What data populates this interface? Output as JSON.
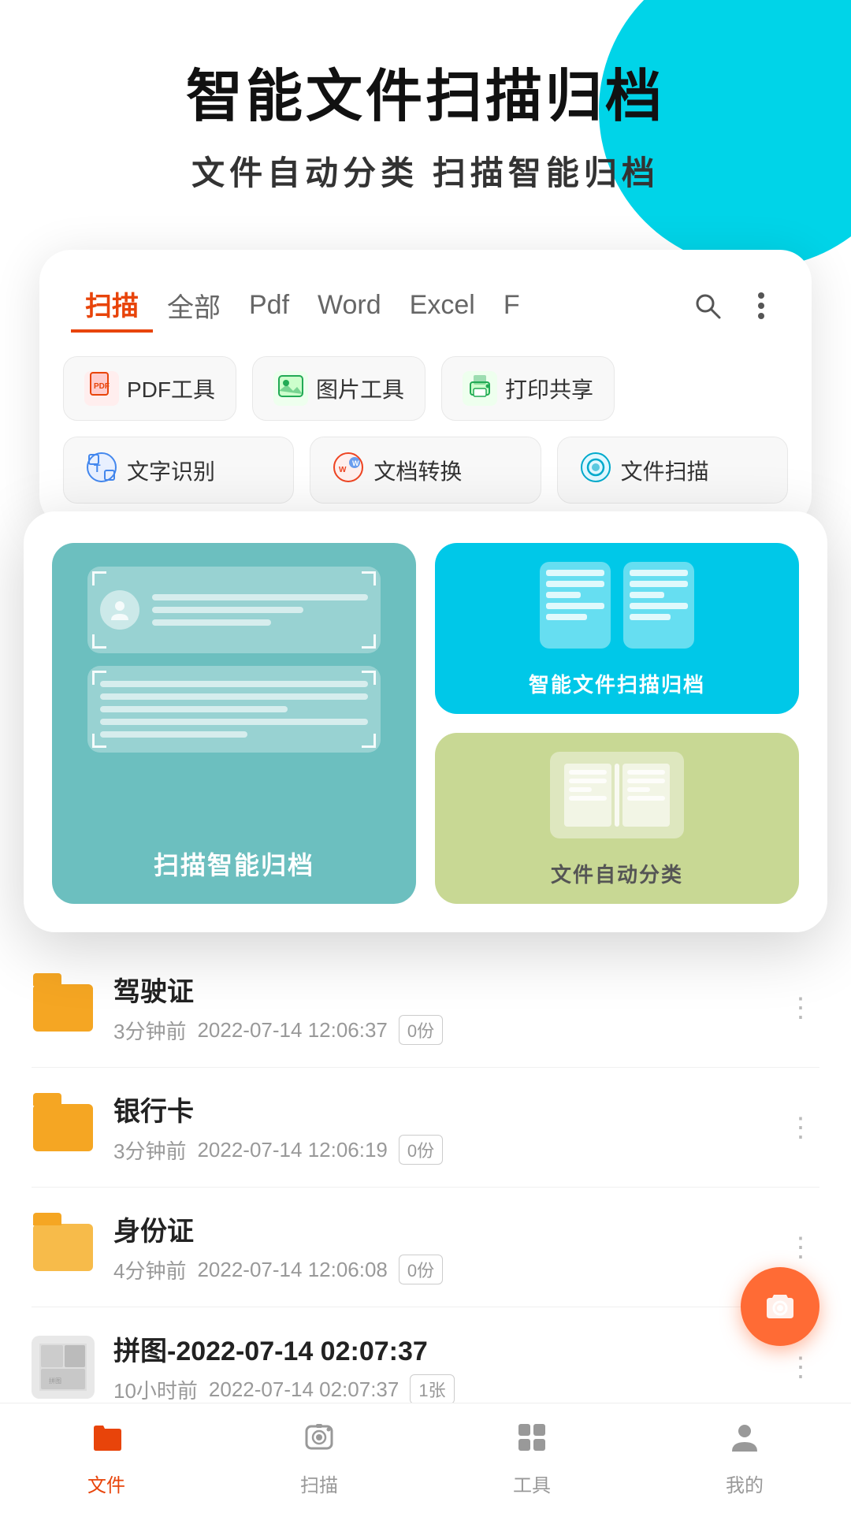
{
  "app": {
    "title": "智能文件扫描归档",
    "subtitle": "文件自动分类   扫描智能归档"
  },
  "tabs": {
    "items": [
      {
        "label": "扫描",
        "active": true
      },
      {
        "label": "全部",
        "active": false
      },
      {
        "label": "Pdf",
        "active": false
      },
      {
        "label": "Word",
        "active": false
      },
      {
        "label": "Excel",
        "active": false
      },
      {
        "label": "F",
        "active": false
      }
    ]
  },
  "tools": [
    {
      "label": "PDF工具",
      "icon": "pdf"
    },
    {
      "label": "图片工具",
      "icon": "img"
    },
    {
      "label": "打印共享",
      "icon": "print"
    }
  ],
  "tools2": [
    {
      "label": "文字识别",
      "icon": "text"
    },
    {
      "label": "文档转换",
      "icon": "convert"
    },
    {
      "label": "文件扫描",
      "icon": "scan"
    }
  ],
  "features": {
    "left_label": "扫描智能归档",
    "right_top_label": "智能文件扫描归档",
    "right_bottom_label": "文件自动分类"
  },
  "files": [
    {
      "name": "驾驶证",
      "time": "3分钟前",
      "date": "2022-07-14 12:06:37",
      "badge": "0份",
      "type": "folder",
      "color": "dark"
    },
    {
      "name": "银行卡",
      "time": "3分钟前",
      "date": "2022-07-14 12:06:19",
      "badge": "0份",
      "type": "folder",
      "color": "dark"
    },
    {
      "name": "身份证",
      "time": "4分钟前",
      "date": "2022-07-14 12:06:08",
      "badge": "0份",
      "type": "folder",
      "color": "light"
    },
    {
      "name": "拼图-2022-07-14 02:07:37",
      "time": "10小时前",
      "date": "2022-07-14 02:07:37",
      "badge": "1张",
      "type": "thumb"
    }
  ],
  "nav": {
    "items": [
      {
        "label": "文件",
        "icon": "folder",
        "active": true
      },
      {
        "label": "扫描",
        "icon": "camera",
        "active": false
      },
      {
        "label": "工具",
        "icon": "grid",
        "active": false
      },
      {
        "label": "我的",
        "icon": "person",
        "active": false
      }
    ]
  },
  "colors": {
    "accent": "#e8440a",
    "active_tab": "#e8440a",
    "cyan": "#00d4e8",
    "teal": "#6cbfbf",
    "light_blue": "#00c8e8",
    "light_green": "#c8d894",
    "fab": "#ff6b35",
    "folder_dark": "#f5a623",
    "folder_light": "#f7bb4a"
  }
}
